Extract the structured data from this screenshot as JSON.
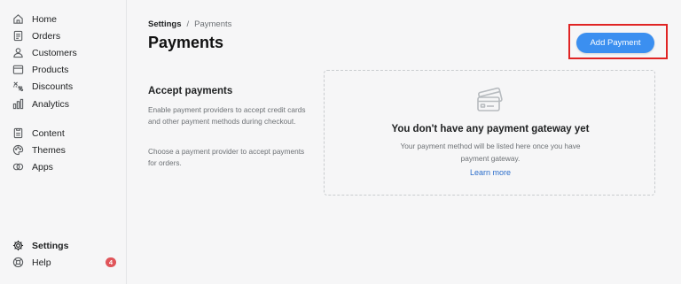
{
  "sidebar": {
    "items": [
      {
        "label": "Home",
        "icon": "home-icon"
      },
      {
        "label": "Orders",
        "icon": "orders-icon"
      },
      {
        "label": "Customers",
        "icon": "customers-icon"
      },
      {
        "label": "Products",
        "icon": "products-icon"
      },
      {
        "label": "Discounts",
        "icon": "discounts-icon"
      },
      {
        "label": "Analytics",
        "icon": "analytics-icon"
      },
      {
        "label": "Content",
        "icon": "content-icon"
      },
      {
        "label": "Themes",
        "icon": "themes-icon"
      },
      {
        "label": "Apps",
        "icon": "apps-icon"
      }
    ],
    "bottom": [
      {
        "label": "Settings",
        "icon": "gear-icon",
        "active": true
      },
      {
        "label": "Help",
        "icon": "help-icon",
        "badge": "4"
      }
    ]
  },
  "breadcrumb": {
    "parent": "Settings",
    "separator": "/",
    "current": "Payments"
  },
  "page": {
    "title": "Payments",
    "add_button": "Add Payment"
  },
  "section": {
    "title": "Accept payments",
    "desc1": "Enable payment providers to accept credit cards and other payment methods during checkout.",
    "desc2": "Choose a payment provider to accept payments for orders."
  },
  "empty_state": {
    "icon": "credit-card-icon",
    "title": "You don't have any payment gateway yet",
    "desc_line1": "Your payment method will be listed here once you have",
    "desc_line2": "payment gateway.",
    "link": "Learn more"
  },
  "colors": {
    "accent": "#3b8ff0",
    "link": "#2c6ecb",
    "highlight": "#e02424",
    "badge": "#e0555a"
  }
}
